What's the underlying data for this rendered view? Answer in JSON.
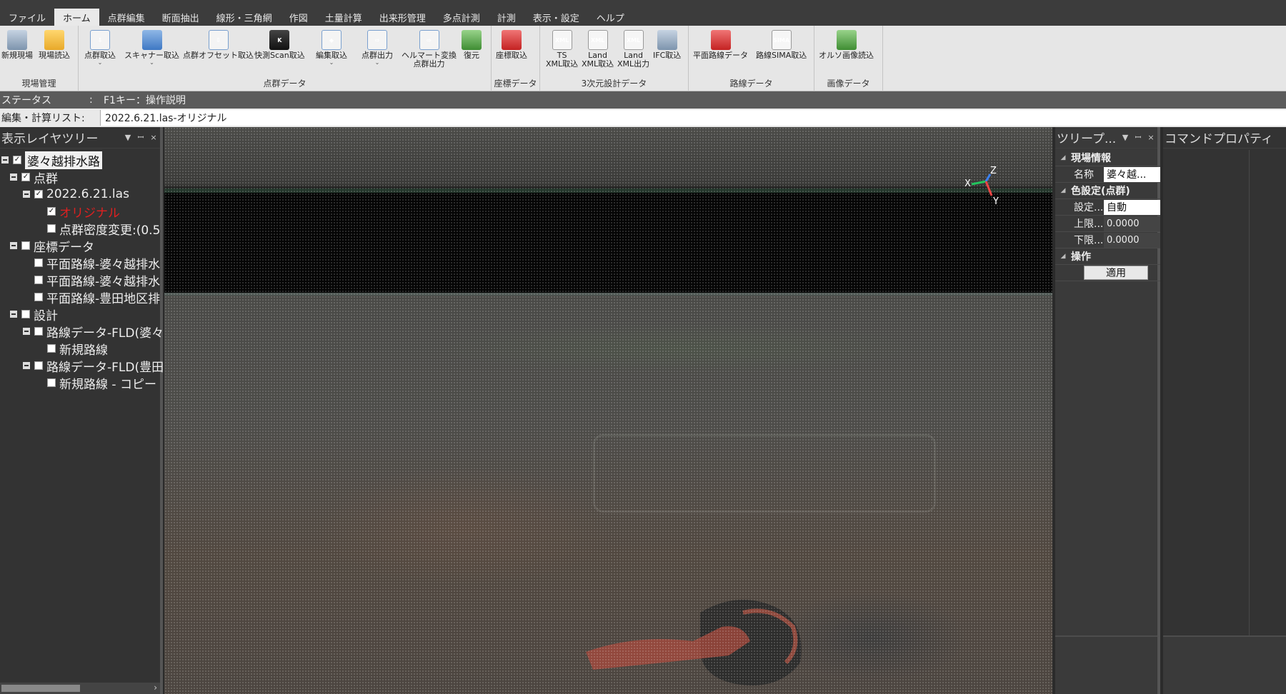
{
  "menu": {
    "tabs": [
      {
        "label": "ファイル",
        "active": false
      },
      {
        "label": "ホーム",
        "active": true
      },
      {
        "label": "点群編集",
        "active": false
      },
      {
        "label": "断面抽出",
        "active": false
      },
      {
        "label": "線形・三角網",
        "active": false
      },
      {
        "label": "作図",
        "active": false
      },
      {
        "label": "土量計算",
        "active": false
      },
      {
        "label": "出来形管理",
        "active": false
      },
      {
        "label": "多点計測",
        "active": false
      },
      {
        "label": "計測",
        "active": false
      },
      {
        "label": "表示・設定",
        "active": false
      },
      {
        "label": "ヘルプ",
        "active": false
      }
    ]
  },
  "ribbon": {
    "groups": {
      "site": "現場管理",
      "pointcloud": "点群データ",
      "coord": "座標データ",
      "design3d": "3次元設計データ",
      "route": "路線データ",
      "image": "画像データ"
    },
    "buttons": {
      "new_site": "新規現場",
      "load_site": "現場読込",
      "import_pc": "点群取込",
      "scanner_import": "スキャナー取込",
      "offset_import": "点群オフセット取込",
      "quick_scan": "快測Scan取込",
      "edit_import": "編集取込",
      "export_pc": "点群出力",
      "helmert": "ヘルマート変換\n点群出力",
      "restore": "復元",
      "coord_import": "座標取込",
      "ts_xml": "TS\nXML取込",
      "land_xml_in": "Land\nXML取込",
      "land_xml_out": "Land\nXML出力",
      "ifc_import": "IFC取込",
      "plane_route": "平面路線データ",
      "sima_route": "路線SIMA取込",
      "ortho": "オルソ画像読込"
    },
    "icon_text": {
      "xml": "XML",
      "sima": "SIMA"
    }
  },
  "status": {
    "label": "ステータス",
    "colon": ":",
    "text": "F1キー：操作説明"
  },
  "calc_list": {
    "label": "編集・計算リスト:",
    "value": "2022.6.21.las-オリジナル"
  },
  "layer_tree": {
    "title": "表示レイヤツリー",
    "nodes": {
      "root": "婆々越排水路",
      "pc": "点群",
      "las": "2022.6.21.las",
      "original": "オリジナル",
      "density": "点群密度変更:(0.5",
      "coord": "座標データ",
      "route1": "平面路線-婆々越排水",
      "route2": "平面路線-婆々越排水",
      "route3": "平面路線-豊田地区排",
      "design": "設計",
      "fld1": "路線データ-FLD(婆々",
      "new_route1": "新規路線",
      "fld2": "路線データ-FLD(豊田",
      "new_route2": "新規路線 - コピー"
    }
  },
  "viewport": {
    "axes": {
      "x": "X",
      "y": "Y",
      "z": "Z"
    }
  },
  "property_panel": {
    "title": "ツリープ...",
    "site_info": "現場情報",
    "name_label": "名称",
    "name_value": "婆々越...",
    "color_cat": "色設定(点群)",
    "setting_label": "設定...",
    "setting_value": "自動",
    "upper_label": "上限...",
    "upper_value": "0.0000",
    "lower_label": "下限...",
    "lower_value": "0.0000",
    "ops_cat": "操作",
    "apply": "適用"
  },
  "command_panel": {
    "title": "コマンドプロパティ"
  },
  "panel_buttons": {
    "dropdown": "▼",
    "pin": "ꟷ",
    "close": "×"
  }
}
